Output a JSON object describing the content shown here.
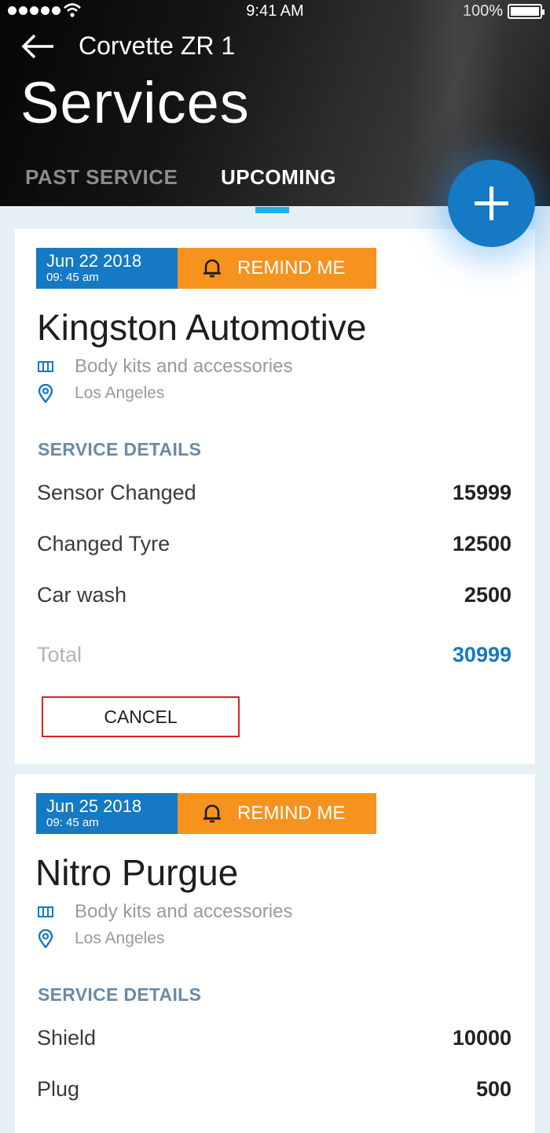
{
  "status_bar": {
    "time": "9:41 AM",
    "battery": "100%"
  },
  "header": {
    "car_name": "Corvette ZR 1",
    "title": "Services",
    "tabs": [
      {
        "label": "PAST SERVICE",
        "active": false
      },
      {
        "label": "UPCOMING",
        "active": true
      }
    ],
    "fab_icon": "plus-icon"
  },
  "colors": {
    "primary": "#1579c4",
    "remind": "#f6921e",
    "cancel_border": "#e02020",
    "tab_indicator": "#1eb0e6",
    "section_head": "#6b8aa3"
  },
  "services": [
    {
      "date": "Jun 22 2018",
      "time": "09: 45 am",
      "remind_label": "REMIND ME",
      "shop": "Kingston Automotive",
      "category": "Body kits and accessories",
      "location": "Los Angeles",
      "section_label": "SERVICE DETAILS",
      "items": [
        {
          "name": "Sensor Changed",
          "amount": "15999"
        },
        {
          "name": "Changed Tyre",
          "amount": "12500"
        },
        {
          "name": "Car wash",
          "amount": "2500"
        }
      ],
      "total_label": "Total",
      "total": "30999",
      "cancel_label": "CANCEL"
    },
    {
      "date": "Jun 25 2018",
      "time": "09: 45 am",
      "remind_label": "REMIND ME",
      "shop": "Nitro Purgue",
      "category": "Body kits and accessories",
      "location": "Los Angeles",
      "section_label": "SERVICE DETAILS",
      "items": [
        {
          "name": "Shield",
          "amount": "10000"
        },
        {
          "name": "Plug",
          "amount": "500"
        }
      ]
    }
  ]
}
